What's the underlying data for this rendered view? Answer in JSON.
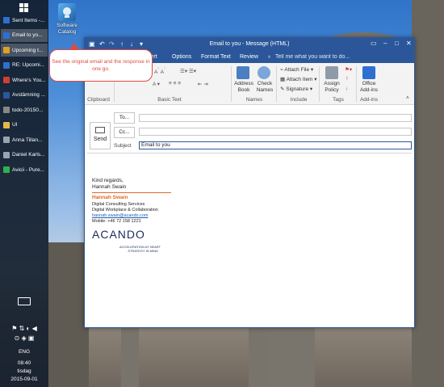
{
  "taskbar": {
    "items": [
      {
        "label": "Sent Items -...",
        "color": "#2f6fd0"
      },
      {
        "label": "Email to yo...",
        "color": "#2f6fd0"
      },
      {
        "label": "Upcoming t...",
        "color": "#e0a020"
      },
      {
        "label": "RE: Upcomi...",
        "color": "#2f6fd0"
      },
      {
        "label": "Where's You...",
        "color": "#d04030"
      },
      {
        "label": "Avstämning ...",
        "color": "#2b579a"
      },
      {
        "label": "todo-20150...",
        "color": "#888888"
      },
      {
        "label": "UI",
        "color": "#e6b84a"
      },
      {
        "label": "Anna Tillan...",
        "color": "#9aa4b0"
      },
      {
        "label": "Daniel Karls...",
        "color": "#9aa4b0"
      },
      {
        "label": "Avicii - Pure...",
        "color": "#30b050"
      }
    ],
    "tray": {
      "lang": "ENG",
      "time": "08:40",
      "day": "tisdag",
      "date": "2015-09-01"
    }
  },
  "desktop_icon": {
    "label_line1": "Software",
    "label_line2": "Catalog"
  },
  "window": {
    "title": "Email to you - Message (HTML)",
    "tabs": [
      "sert",
      "Options",
      "Format Text",
      "Review"
    ],
    "tell_me": "Tell me what you want to do...",
    "ribbon": {
      "groups": [
        "Clipboard",
        "Basic Text",
        "Names",
        "Include",
        "Tags",
        "Add-ins"
      ],
      "address_book": "Address Book",
      "check_names": "Check Names",
      "attach_file": "Attach File",
      "attach_item": "Attach Item",
      "signature": "Signature",
      "assign_policy": "Assign Policy",
      "office_addins": "Office Add-ins"
    },
    "compose": {
      "send": "Send",
      "to": "To...",
      "cc": "Cc...",
      "subject_label": "Subject",
      "to_value": "",
      "cc_value": "",
      "subject_value": "Email to you"
    },
    "signature": {
      "greeting": "Kind regards,",
      "name_plain": "Hannah Swain",
      "name_orange": "Hannah Swain",
      "title": "Digital Consulting Services",
      "dept": "Digital Workplace & Collaboration",
      "email": "hannah.swain@acando.com",
      "mobile": "Mobile: +46 72 158 1221",
      "logo": "ACANDO",
      "tagline1": "ACCELERATION AT HEART",
      "tagline2": "STRATEGY IN MIND"
    }
  },
  "callout": {
    "text": "See the original email and the response in one go.",
    "color": "#e04a3f"
  }
}
